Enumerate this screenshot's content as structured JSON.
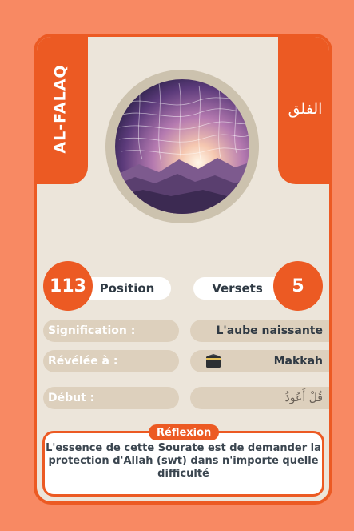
{
  "card": {
    "name_vertical": "AL-FALAQ",
    "arabic_title": "الفلق",
    "position_value": "113",
    "position_label": "Position",
    "verses_label": "Versets",
    "verses_value": "5",
    "rows": [
      {
        "label": "Signification :",
        "value": "L'aube naissante"
      },
      {
        "label": "Révélée à :",
        "value": "Makkah",
        "icon": "kaaba-icon"
      },
      {
        "label": "Début :",
        "value": "قُلْ أَعُوذُ"
      }
    ],
    "reflection_label": "Réflexion",
    "reflection_text": "L'essence de cette Sourate est de demander la protection d'Allah (swt) dans n'importe quelle difficulté"
  },
  "colors": {
    "background": "#f88963",
    "accent": "#ec5a23",
    "card": "#ece5da",
    "row": "#ddd0bd"
  }
}
